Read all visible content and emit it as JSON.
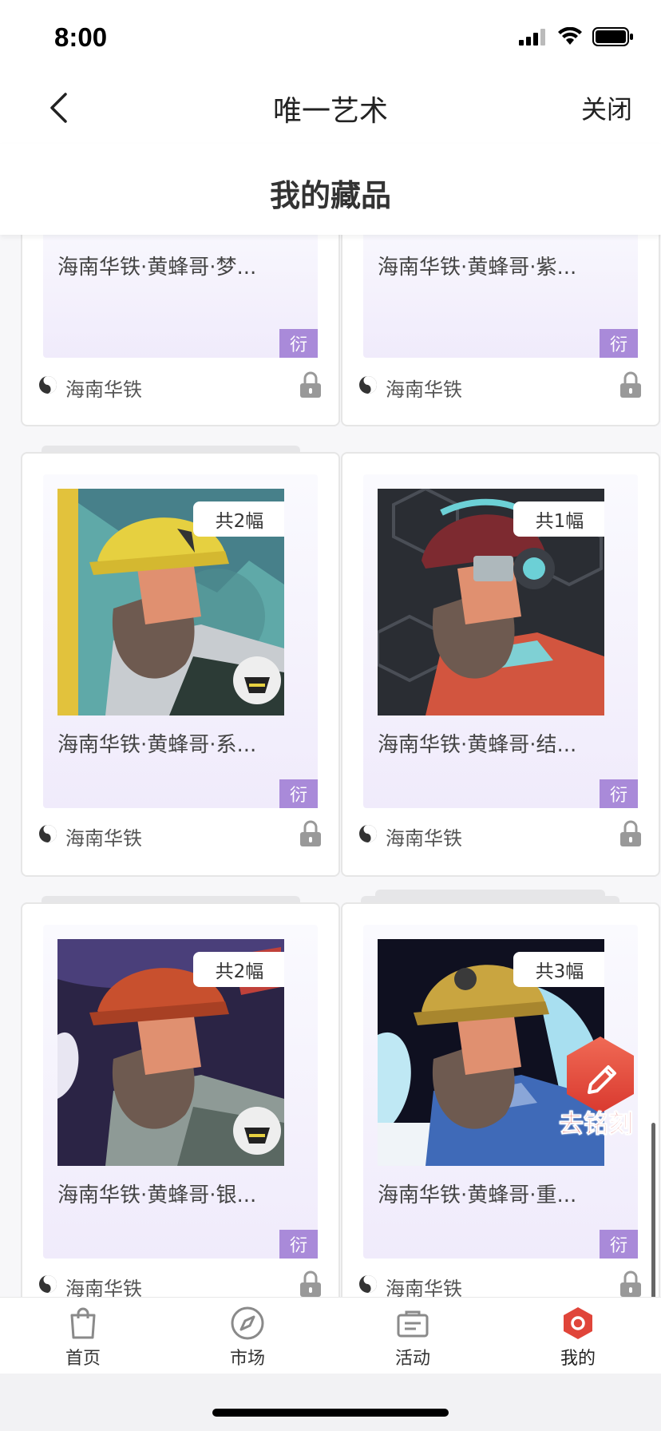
{
  "status_bar": {
    "time": "8:00"
  },
  "nav": {
    "title": "唯一艺术",
    "close_label": "关闭"
  },
  "page": {
    "subtitle": "我的藏品"
  },
  "cards": [
    {
      "title": "海南华铁·黄蜂哥·梦...",
      "tag": "衍",
      "issuer": "海南华铁",
      "count": ""
    },
    {
      "title": "海南华铁·黄蜂哥·紫...",
      "tag": "衍",
      "issuer": "海南华铁",
      "count": ""
    },
    {
      "title": "海南华铁·黄蜂哥·系...",
      "tag": "衍",
      "issuer": "海南华铁",
      "count": "共2幅"
    },
    {
      "title": "海南华铁·黄蜂哥·结...",
      "tag": "衍",
      "issuer": "海南华铁",
      "count": "共1幅"
    },
    {
      "title": "海南华铁·黄蜂哥·银...",
      "tag": "衍",
      "issuer": "海南华铁",
      "count": "共2幅"
    },
    {
      "title": "海南华铁·黄蜂哥·重...",
      "tag": "衍",
      "issuer": "海南华铁",
      "count": "共3幅"
    }
  ],
  "floating": {
    "engrave_label": "去铭刻"
  },
  "tabs": [
    {
      "label": "首页",
      "icon": "bag-icon"
    },
    {
      "label": "市场",
      "icon": "compass-icon"
    },
    {
      "label": "活动",
      "icon": "ticket-icon"
    },
    {
      "label": "我的",
      "icon": "profile-hexagon-icon",
      "active": true
    }
  ],
  "colors": {
    "accent": "#e0453a",
    "tag_purple": "#a98ad9"
  }
}
